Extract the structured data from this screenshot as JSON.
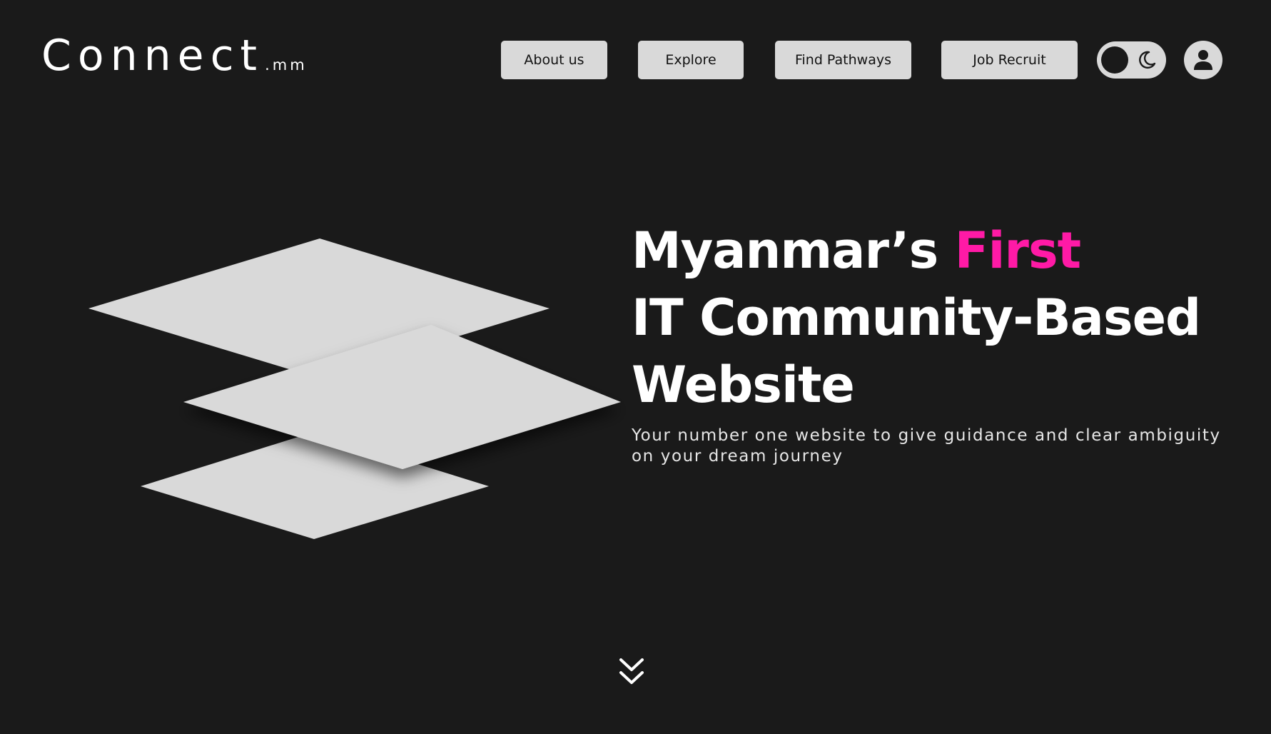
{
  "logo": {
    "main": "Connect",
    "suffix": ".mm"
  },
  "nav": {
    "items": [
      {
        "label": "About us"
      },
      {
        "label": "Explore"
      },
      {
        "label": "Find Pathways"
      },
      {
        "label": "Job Recruit"
      }
    ]
  },
  "theme_toggle": {
    "icon": "moon-icon",
    "mode": "dark"
  },
  "profile": {
    "icon": "user-icon"
  },
  "hero": {
    "title_line1": "Myanmar’s ",
    "title_accent": "First",
    "title_line2": "IT Community-Based",
    "title_line3": "Website",
    "subtitle": "Your number one website to give guidance and clear ambiguity on your dream journey"
  },
  "scroll": {
    "icon": "double-chevron-down-icon"
  },
  "colors": {
    "background": "#1a1a1a",
    "accent": "#ff1aa6",
    "button": "#d9d9d9",
    "text": "#ffffff"
  }
}
